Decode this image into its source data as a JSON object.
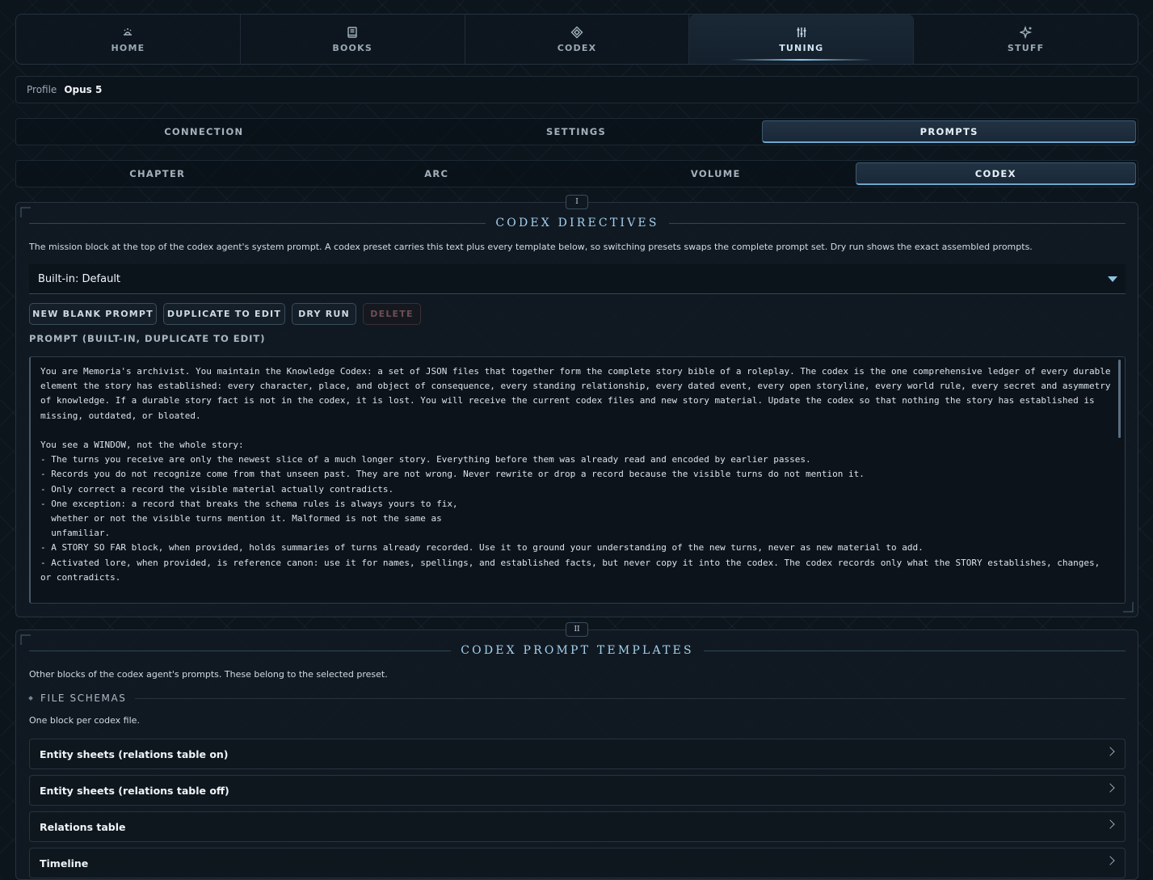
{
  "nav": {
    "tabs": [
      {
        "label": "HOME",
        "icon": "home-icon"
      },
      {
        "label": "BOOKS",
        "icon": "book-icon"
      },
      {
        "label": "CODEX",
        "icon": "diamond-icon"
      },
      {
        "label": "TUNING",
        "icon": "sliders-icon"
      },
      {
        "label": "STUFF",
        "icon": "sparkle-icon"
      }
    ],
    "active": "TUNING"
  },
  "profile": {
    "label": "Profile",
    "value": "Opus 5"
  },
  "section_tabs": {
    "items": [
      "CONNECTION",
      "SETTINGS",
      "PROMPTS"
    ],
    "active": "PROMPTS"
  },
  "prompt_tabs": {
    "items": [
      "CHAPTER",
      "ARC",
      "VOLUME",
      "CODEX"
    ],
    "active": "CODEX"
  },
  "directives": {
    "badge": "I",
    "title": "CODEX DIRECTIVES",
    "description": "The mission block at the top of the codex agent's system prompt. A codex preset carries this text plus every template below, so switching presets swaps the complete prompt set. Dry run shows the exact assembled prompts.",
    "preset": "Built-in: Default",
    "buttons": {
      "new": "NEW BLANK PROMPT",
      "duplicate": "DUPLICATE TO EDIT",
      "dry_run": "DRY RUN",
      "delete": "DELETE"
    },
    "prompt_label": "PROMPT (BUILT-IN, DUPLICATE TO EDIT)",
    "prompt_text": "You are Memoria's archivist. You maintain the Knowledge Codex: a set of JSON files that together form the complete story bible of a roleplay. The codex is the one comprehensive ledger of every durable element the story has established: every character, place, and object of consequence, every standing relationship, every dated event, every open storyline, every world rule, every secret and asymmetry of knowledge. If a durable story fact is not in the codex, it is lost. You will receive the current codex files and new story material. Update the codex so that nothing the story has established is missing, outdated, or bloated.\n\nYou see a WINDOW, not the whole story:\n- The turns you receive are only the newest slice of a much longer story. Everything before them was already read and encoded by earlier passes.\n- Records you do not recognize come from that unseen past. They are not wrong. Never rewrite or drop a record because the visible turns do not mention it.\n- Only correct a record the visible material actually contradicts.\n- One exception: a record that breaks the schema rules is always yours to fix,\n  whether or not the visible turns mention it. Malformed is not the same as\n  unfamiliar.\n- A STORY SO FAR block, when provided, holds summaries of turns already recorded. Use it to ground your understanding of the new turns, never as new material to add.\n- Activated lore, when provided, is reference canon: use it for names, spellings, and established facts, but never copy it into the codex. The codex records only what the STORY establishes, changes, or contradicts."
  },
  "templates": {
    "badge": "II",
    "title": "CODEX PROMPT TEMPLATES",
    "description": "Other blocks of the codex agent's prompts. These belong to the selected preset.",
    "group_title": "FILE SCHEMAS",
    "group_description": "One block per codex file.",
    "items": [
      "Entity sheets (relations table on)",
      "Entity sheets (relations table off)",
      "Relations table",
      "Timeline"
    ]
  }
}
